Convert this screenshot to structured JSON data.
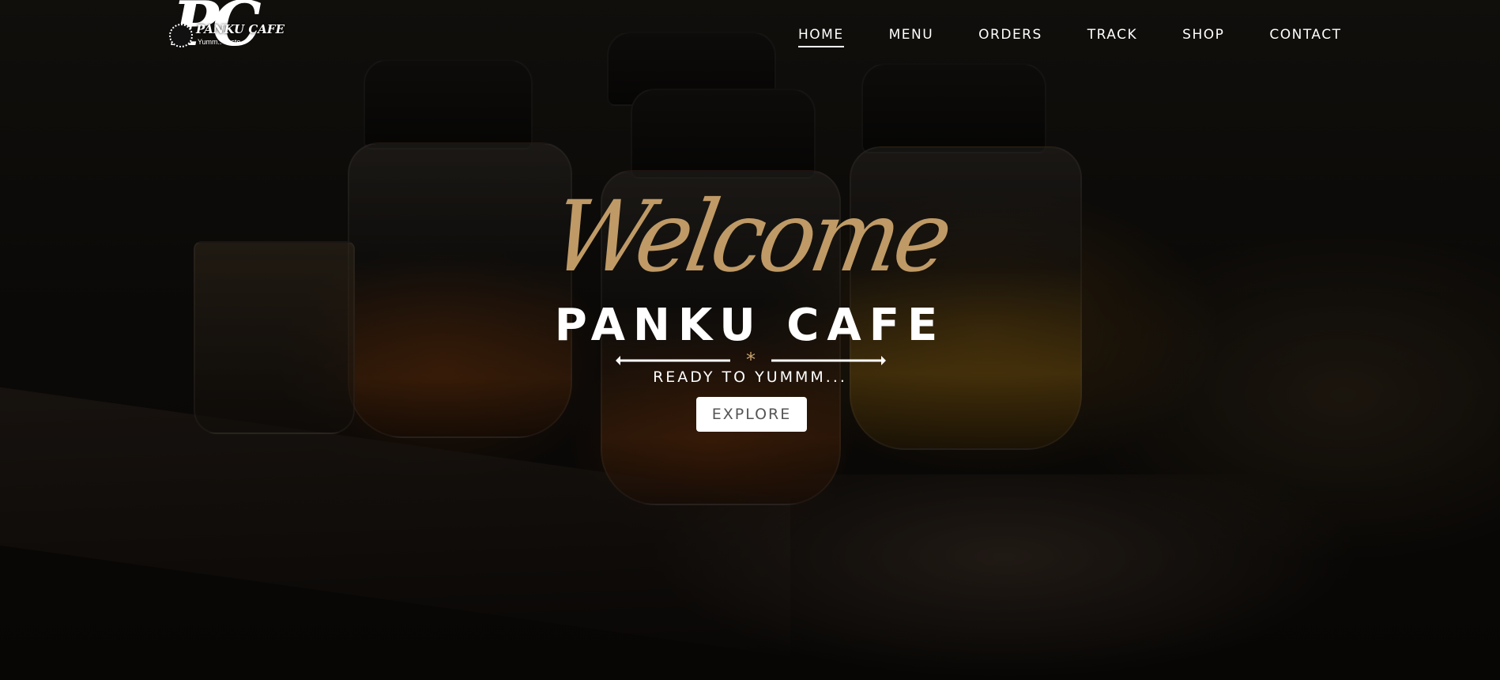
{
  "brand": {
    "monogram": "PC",
    "name": "PANKU CAFE",
    "tagline": "Yumm.. Taste"
  },
  "nav": {
    "items": [
      {
        "label": "HOME",
        "active": true
      },
      {
        "label": "MENU",
        "active": false
      },
      {
        "label": "ORDERS",
        "active": false
      },
      {
        "label": "TRACK",
        "active": false
      },
      {
        "label": "SHOP",
        "active": false
      },
      {
        "label": "CONTACT",
        "active": false
      }
    ]
  },
  "hero": {
    "welcome": "Welcome",
    "title": "PANKU CAFE",
    "subtitle": "READY TO YUMMM...",
    "cta_label": "EXPLORE"
  },
  "colors": {
    "accent_gold": "#c9a26b",
    "text": "#ffffff",
    "button_bg": "#ffffff",
    "button_text": "#555555"
  },
  "icons": {
    "divider": "star-divider-icon",
    "logo_badge": "cafe-badge-icon"
  }
}
